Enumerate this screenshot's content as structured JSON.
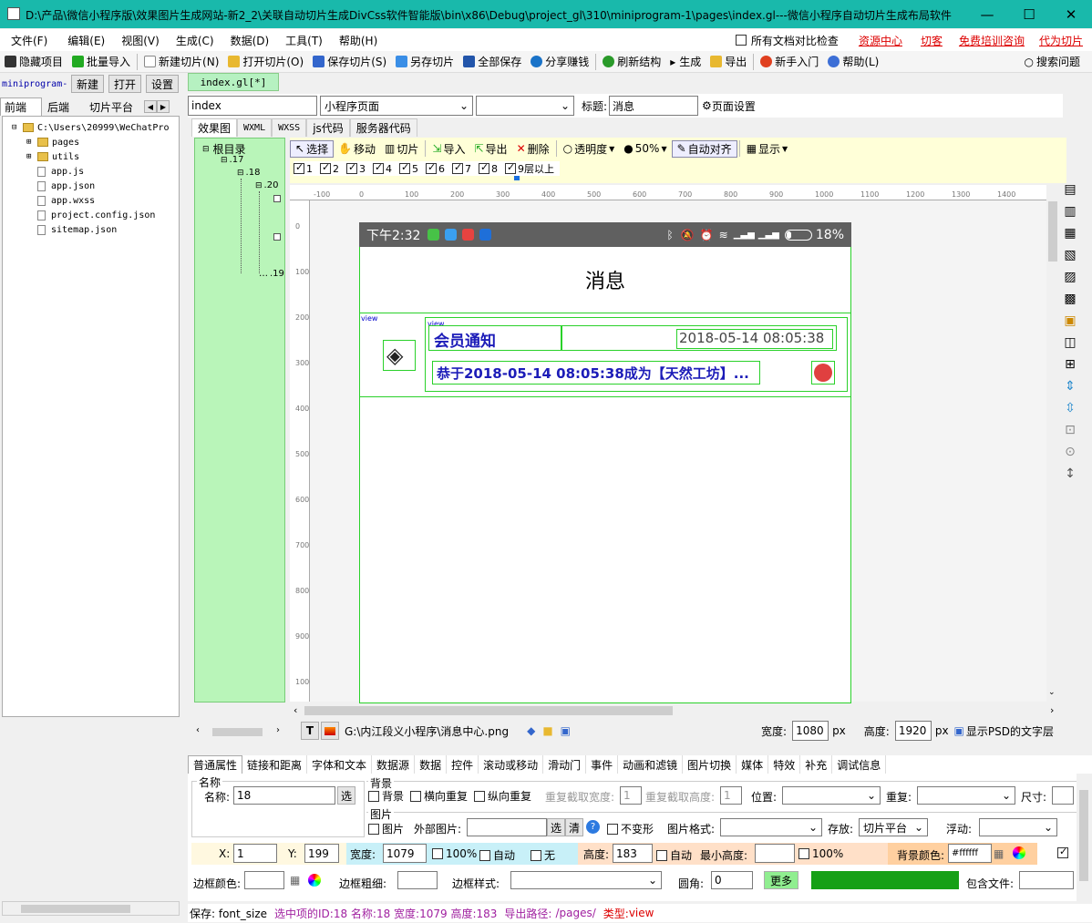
{
  "window": {
    "title": "D:\\产品\\微信小程序版\\效果图片生成网站-新2_2\\关联自动切片生成DivCss软件智能版\\bin\\x86\\Debug\\project_gl\\310\\miniprogram-1\\pages\\index.gl---微信小程序自动切片生成布局软件"
  },
  "menu": [
    "文件(F)",
    "编辑(E)",
    "视图(V)",
    "生成(C)",
    "数据(D)",
    "工具(T)",
    "帮助(H)"
  ],
  "menu_right": {
    "compare": "所有文档对比检查",
    "links": [
      "资源中心",
      "切客",
      "免费培训咨询",
      "代为切片"
    ]
  },
  "toolbar": [
    "隐藏项目",
    "批量导入",
    "新建切片(N)",
    "打开切片(O)",
    "保存切片(S)",
    "另存切片",
    "全部保存",
    "分享赚钱",
    "刷新结构",
    "生成",
    "导出",
    "新手入门",
    "帮助(L)"
  ],
  "search": "搜索问题",
  "left": {
    "project": "miniprogram-",
    "buttons": [
      "新建",
      "打开",
      "设置"
    ],
    "tabs": [
      "前端",
      "后端",
      "切片平台"
    ],
    "tree": [
      {
        "t": "C:\\Users\\20999\\WeChatPro",
        "k": "folder",
        "d": 0
      },
      {
        "t": "pages",
        "k": "folder",
        "d": 1
      },
      {
        "t": "utils",
        "k": "folder",
        "d": 1
      },
      {
        "t": "app.js",
        "k": "file",
        "d": 1
      },
      {
        "t": "app.json",
        "k": "file",
        "d": 1
      },
      {
        "t": "app.wxss",
        "k": "file",
        "d": 1
      },
      {
        "t": "project.config.json",
        "k": "file",
        "d": 1
      },
      {
        "t": "sitemap.json",
        "k": "file",
        "d": 1
      }
    ]
  },
  "doc_tab": "index.gl[*]",
  "pagebar": {
    "name": "index",
    "type": "小程序页面",
    "title_label": "标题:",
    "title_value": "消息",
    "page_settings": "页面设置"
  },
  "code_tabs": [
    "效果图",
    "WXML",
    "WXSS",
    "js代码",
    "服务器代码"
  ],
  "outline": [
    "根目录",
    ".17",
    ".18",
    ".20",
    ".19"
  ],
  "edit_tools": [
    "选择",
    "移动",
    "切片",
    "导入",
    "导出",
    "删除",
    "透明度",
    "50%",
    "自动对齐",
    "显示"
  ],
  "layers": [
    "1",
    "2",
    "3",
    "4",
    "5",
    "6",
    "7",
    "8",
    "9层以上"
  ],
  "ruler_h": [
    "-100",
    "0",
    "100",
    "200",
    "300",
    "400",
    "500",
    "600",
    "700",
    "800",
    "900",
    "1000",
    "1100",
    "1200",
    "1300",
    "1400"
  ],
  "ruler_v": [
    "0",
    "100",
    "200",
    "300",
    "400",
    "500",
    "600",
    "700",
    "800",
    "900",
    "1000"
  ],
  "phone": {
    "time": "下午2:32",
    "battery": "18%",
    "page_title": "消息",
    "notice_title": "会员通知",
    "notice_time": "2018-05-14 08:05:38",
    "notice_text": "恭于2018-05-14 08:05:38成为【天然工坊】...",
    "tag_view": "view",
    "tag_view2": "view"
  },
  "filebar": {
    "path": "G:\\内江段义小程序\\消息中心.png",
    "width_label": "宽度:",
    "width": "1080",
    "px": "px",
    "height_label": "高度:",
    "height": "1920",
    "psd": "显示PSD的文字层"
  },
  "prop_tabs": [
    "普通属性",
    "链接和距离",
    "字体和文本",
    "数据源",
    "数据",
    "控件",
    "滚动或移动",
    "滑动门",
    "事件",
    "动画和滤镜",
    "图片切换",
    "媒体",
    "特效",
    "补充",
    "调试信息"
  ],
  "props": {
    "name_group": "名称",
    "name_label": "名称:",
    "name_value": "18",
    "choose": "选",
    "bg_group": "背景",
    "bg": "背景",
    "hrepeat": "横向重复",
    "vrepeat": "纵向重复",
    "rw": "重复截取宽度:",
    "rw_v": "1",
    "rh": "重复截取高度:",
    "rh_v": "1",
    "pos": "位置:",
    "repeat": "重复:",
    "size": "尺寸:",
    "img_group": "图片",
    "img": "图片",
    "ext_img": "外部图片:",
    "clear": "清",
    "nodeform": "不变形",
    "imgfmt": "图片格式:",
    "store": "存放:",
    "store_v": "切片平台",
    "float": "浮动:",
    "x_label": "X:",
    "x": "1",
    "y_label": "Y:",
    "y": "199",
    "w_label": "宽度:",
    "w": "1079",
    "pct": "100%",
    "auto": "自动",
    "none": "无",
    "h_label": "高度:",
    "h": "183",
    "minh": "最小高度:",
    "bgcolor_label": "背景颜色:",
    "bgcolor": "#ffffff",
    "border_color": "边框颜色:",
    "border_w": "边框粗细:",
    "border_style": "边框样式:",
    "radius": "圆角:",
    "radius_v": "0",
    "more": "更多",
    "include": "包含文件:"
  },
  "statusbar": {
    "save": "保存: font_size",
    "selected": "选中项的ID:18 名称:18 宽度:1079 高度:183",
    "export_label": "导出路径:",
    "export": "/pages/",
    "type_label": "类型:",
    "type": "view"
  }
}
